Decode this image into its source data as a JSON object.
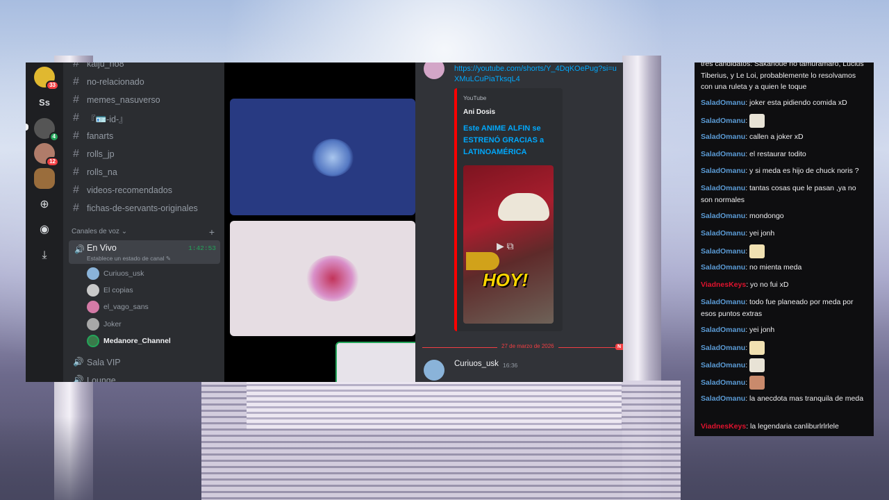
{
  "discord": {
    "servers": [
      {
        "label": "",
        "badge": "33",
        "color": "#e0b830"
      },
      {
        "label": "Ss",
        "badge": "",
        "color": "#1e1f22"
      },
      {
        "label": "",
        "badge": "4",
        "color": "#555555"
      },
      {
        "label": "",
        "badge": "12",
        "color": "#b07c6a"
      },
      {
        "label": "",
        "badge": "",
        "color": "#9a6d3c"
      }
    ],
    "channels": [
      "kaiju_no8",
      "no-relacionado",
      "memes_nasuverso",
      "『🪪-id-』",
      "fanarts",
      "rolls_jp",
      "rolls_na",
      "videos-recomendados",
      "fichas-de-servants-originales"
    ],
    "voice_header": "Canales de voz",
    "active_voice": {
      "name": "En Vivo",
      "time": "1:42:53",
      "status": "Establece un estado de canal"
    },
    "members": [
      {
        "name": "Curiuos_usk",
        "bold": false,
        "color": "#8ab3d9"
      },
      {
        "name": "El copias",
        "bold": false,
        "color": "#c9c9c9"
      },
      {
        "name": "el_vago_sans",
        "bold": false,
        "color": "#d47aa6"
      },
      {
        "name": "Joker",
        "bold": false,
        "color": "#a8a8a8"
      },
      {
        "name": "Medanore_Channel",
        "bold": true,
        "color": "#3a7a4a"
      }
    ],
    "other_voice": [
      "Sala VIP",
      "Lounge"
    ],
    "chat": {
      "link": "https://youtube.com/shorts/Y_4DqKOePug?si=uXMuLCuPiaTksqL4",
      "embed_provider": "YouTube",
      "embed_author": "Ani Dosis",
      "embed_title": "Este ANIME ALFIN se ESTRENÓ GRACIAS a LATINOAMÉRICA",
      "thumb_text": "HOY!",
      "date_divider": "27 de marzo de 2026",
      "new_label": "NUEVO",
      "last_author": "Curiuos_usk",
      "last_time": "16:36"
    }
  },
  "twitch": {
    "messages": [
      {
        "user": "",
        "text": "tres candidatos: Sakanoue no tamuramaro, Lucius Tiberius, y Le Loi, probablemente lo resolvamos con una ruleta y a quien le toque",
        "red": false,
        "emote": ""
      },
      {
        "user": "SaladOmanu",
        "text": ": joker esta pidiendo comida xD",
        "red": false,
        "emote": ""
      },
      {
        "user": "SaladOmanu",
        "text": ":",
        "red": false,
        "emote": "#e8e3d6"
      },
      {
        "user": "SaladOmanu",
        "text": ": callen a joker xD",
        "red": false,
        "emote": ""
      },
      {
        "user": "SaladOmanu",
        "text": ": el restaurar todito",
        "red": false,
        "emote": ""
      },
      {
        "user": "SaladOmanu",
        "text": ": y si meda es hijo de chuck noris ?",
        "red": false,
        "emote": ""
      },
      {
        "user": "SaladOmanu",
        "text": ": tantas cosas que le pasan ,ya no son normales",
        "red": false,
        "emote": ""
      },
      {
        "user": "SaladOmanu",
        "text": ": mondongo",
        "red": false,
        "emote": ""
      },
      {
        "user": "SaladOmanu",
        "text": ": yei jonh",
        "red": false,
        "emote": ""
      },
      {
        "user": "SaladOmanu",
        "text": ":",
        "red": false,
        "emote": "#f1e1b2"
      },
      {
        "user": "SaladOmanu",
        "text": ": no mienta meda",
        "red": false,
        "emote": ""
      },
      {
        "user": "ViadnesKeys",
        "text": ": yo no fui xD",
        "red": true,
        "emote": ""
      },
      {
        "user": "SaladOmanu",
        "text": ": todo fue planeado por meda por esos puntos extras",
        "red": false,
        "emote": ""
      },
      {
        "user": "SaladOmanu",
        "text": ": yei jonh",
        "red": false,
        "emote": ""
      },
      {
        "user": "SaladOmanu",
        "text": ":",
        "red": false,
        "emote": "#f1e1b2"
      },
      {
        "user": "SaladOmanu",
        "text": ":",
        "red": false,
        "emote": "#e8e3d6"
      },
      {
        "user": "SaladOmanu",
        "text": ":",
        "red": false,
        "emote": "#c98a6c"
      },
      {
        "user": "SaladOmanu",
        "text": ": la anecdota mas tranquila de meda",
        "red": false,
        "emote": ""
      },
      {
        "user": "ViadnesKeys",
        "text": ": la legendaria canliburlrlrlele",
        "red": true,
        "emote": ""
      }
    ]
  }
}
